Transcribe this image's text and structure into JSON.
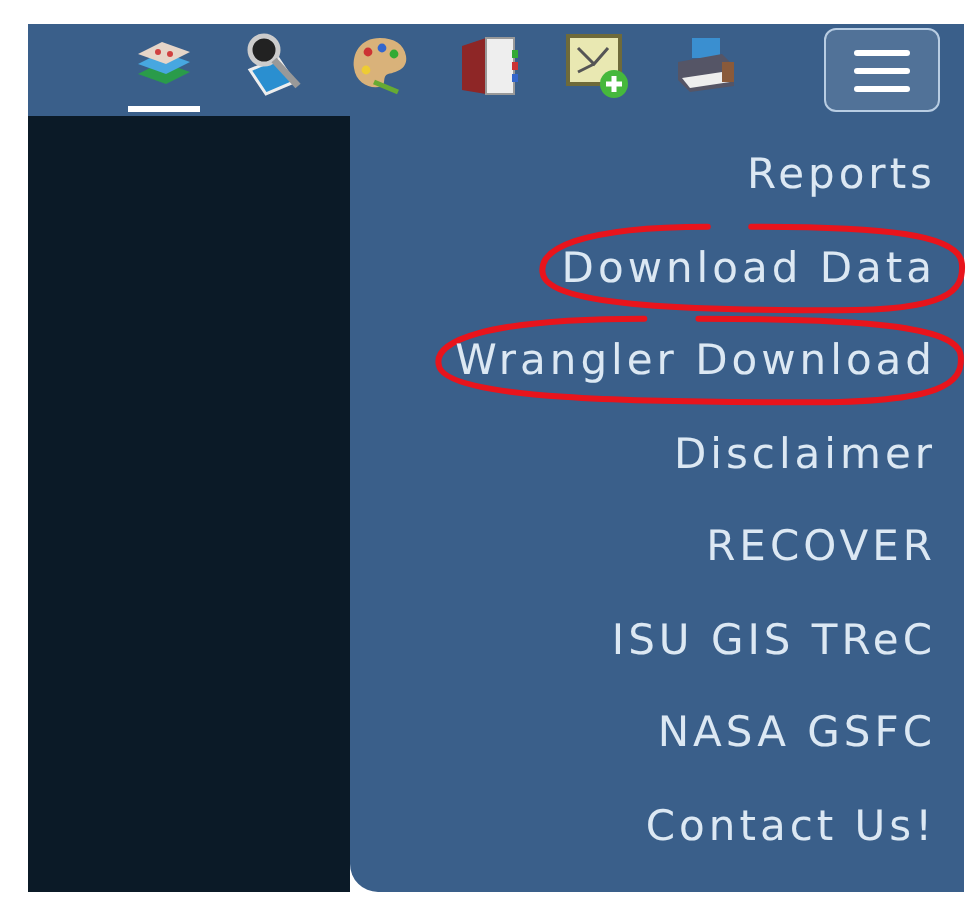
{
  "toolbar": {
    "tools": [
      {
        "kind": "layers",
        "selected": true
      },
      {
        "kind": "search-image",
        "selected": false
      },
      {
        "kind": "palette",
        "selected": false
      },
      {
        "kind": "book",
        "selected": false
      },
      {
        "kind": "map-add",
        "selected": false
      },
      {
        "kind": "printer",
        "selected": false
      }
    ],
    "menu_button": {
      "expanded": true
    }
  },
  "menu": {
    "items": [
      {
        "label": "Reports",
        "circled": false
      },
      {
        "label": "Download Data",
        "circled": true
      },
      {
        "label": "Wrangler Download",
        "circled": true
      },
      {
        "label": "Disclaimer",
        "circled": false
      },
      {
        "label": "RECOVER",
        "circled": false
      },
      {
        "label": "ISU GIS TReC",
        "circled": false
      },
      {
        "label": "NASA GSFC",
        "circled": false
      },
      {
        "label": "Contact Us!",
        "circled": false
      }
    ]
  }
}
